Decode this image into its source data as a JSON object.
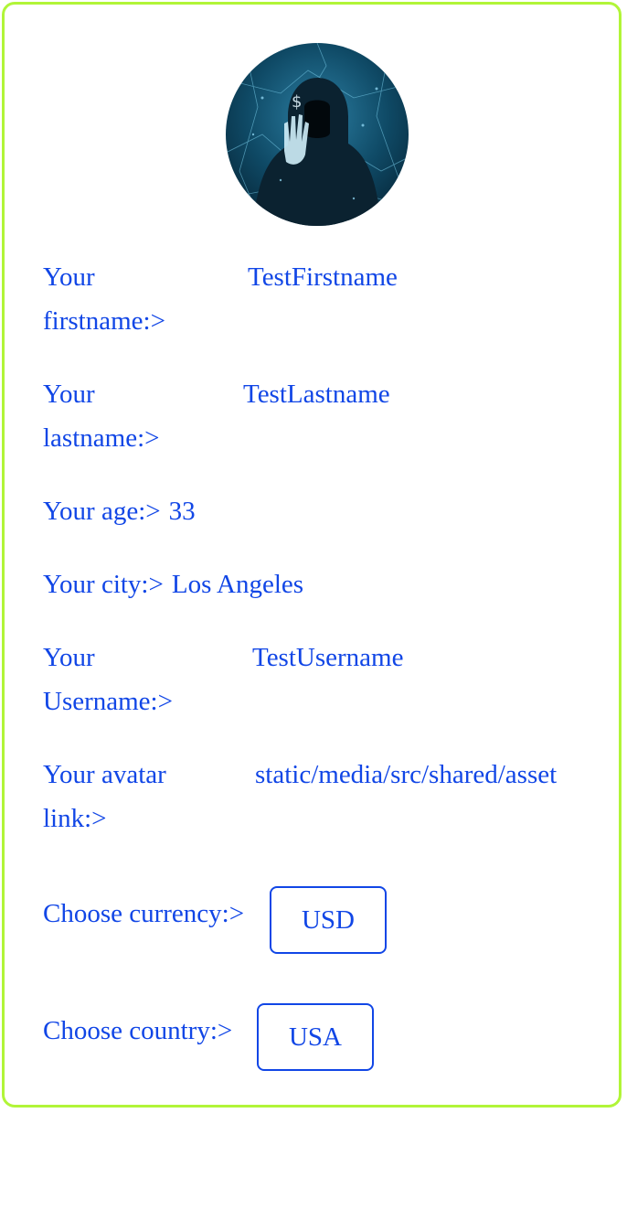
{
  "profile": {
    "avatar": {
      "icon": "hooded-hacker-avatar"
    },
    "firstname": {
      "label_line1": "Your",
      "label_line2": "firstname:>",
      "value": "TestFirstname"
    },
    "lastname": {
      "label_line1": "Your",
      "label_line2": "lastname:>",
      "value": "TestLastname"
    },
    "age": {
      "label": "Your age:>",
      "value": "33"
    },
    "city": {
      "label": "Your city:>",
      "value": "Los Angeles"
    },
    "username": {
      "label_line1": "Your",
      "label_line2": "Username:>",
      "value": "TestUsername"
    },
    "avatar_link": {
      "label_line1": "Your avatar",
      "label_line2": "link:>",
      "value": "static/media/src/shared/asset"
    },
    "currency": {
      "label": "Choose currency:>",
      "button": "USD"
    },
    "country": {
      "label": "Choose country:>",
      "button": "USA"
    }
  },
  "colors": {
    "text": "#1146e6",
    "card_border": "#b1f538",
    "background": "#ffffff"
  }
}
